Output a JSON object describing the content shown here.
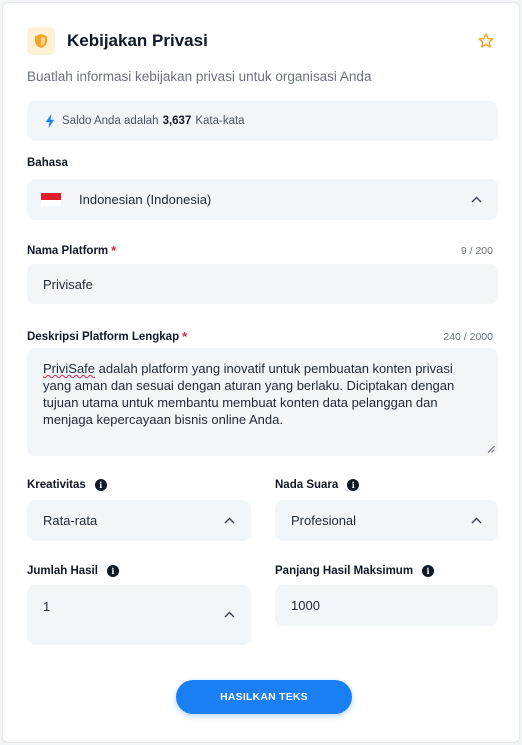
{
  "header": {
    "title": "Kebijakan Privasi",
    "icon": "shield-icon",
    "favorite_icon": "star-icon"
  },
  "subtitle": "Buatlah informasi kebijakan privasi untuk organisasi Anda",
  "balance": {
    "prefix": "Saldo Anda adalah",
    "amount": "3,637",
    "suffix": "Kata-kata",
    "icon": "bolt-icon"
  },
  "language": {
    "label": "Bahasa",
    "value": "Indonesian (Indonesia)",
    "flag": "indonesia-flag"
  },
  "platform_name": {
    "label": "Nama Platform",
    "required": "*",
    "counter": "9 / 200",
    "value": "Privisafe"
  },
  "platform_description": {
    "label": "Deskripsi Platform Lengkap",
    "required": "*",
    "counter": "240 / 2000",
    "first_word": "PriviSafe",
    "value_rest": " adalah platform yang inovatif untuk pembuatan konten privasi yang aman dan sesuai dengan aturan yang berlaku. Diciptakan dengan tujuan utama untuk membantu membuat konten data pelanggan dan menjaga kepercayaan bisnis online Anda."
  },
  "creativity": {
    "label": "Kreativitas",
    "value": "Rata-rata"
  },
  "tone": {
    "label": "Nada Suara",
    "value": "Profesional"
  },
  "result_count": {
    "label": "Jumlah Hasil",
    "value": "1"
  },
  "max_length": {
    "label": "Panjang Hasil Maksimum",
    "value": "1000"
  },
  "submit_label": "HASILKAN TEKS",
  "colors": {
    "accent": "#1a7ff5",
    "required": "#e11d48",
    "field_bg": "#f3f6f9",
    "icon_bg": "#fff1d6",
    "icon_fg": "#f5a524"
  }
}
